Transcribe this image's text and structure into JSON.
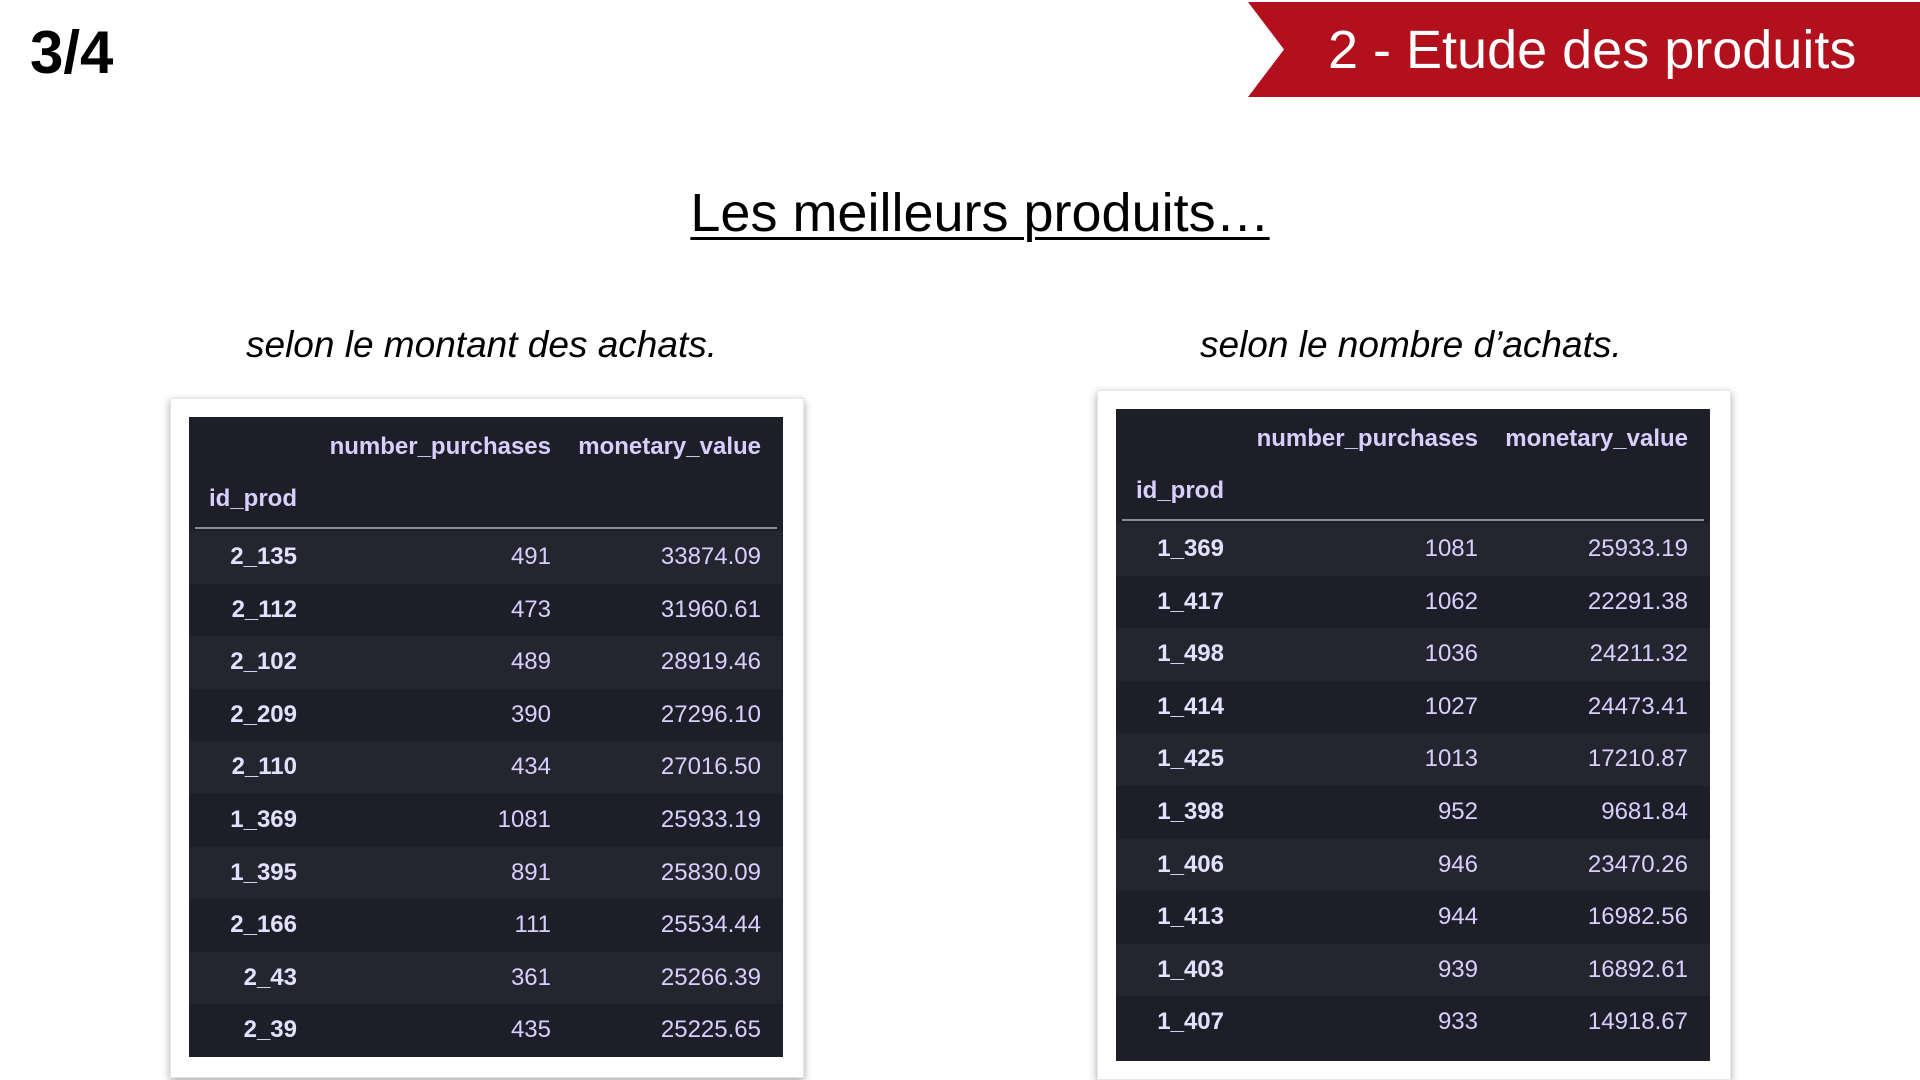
{
  "page_number": "3/4",
  "section_banner": "2 - Etude des produits",
  "title": "Les meilleurs produits…",
  "left": {
    "subtitle": "selon le montant des achats.",
    "columns": [
      "number_purchases",
      "monetary_value"
    ],
    "index_name": "id_prod",
    "rows": [
      {
        "id": "2_135",
        "number_purchases": "491",
        "monetary_value": "33874.09"
      },
      {
        "id": "2_112",
        "number_purchases": "473",
        "monetary_value": "31960.61"
      },
      {
        "id": "2_102",
        "number_purchases": "489",
        "monetary_value": "28919.46"
      },
      {
        "id": "2_209",
        "number_purchases": "390",
        "monetary_value": "27296.10"
      },
      {
        "id": "2_110",
        "number_purchases": "434",
        "monetary_value": "27016.50"
      },
      {
        "id": "1_369",
        "number_purchases": "1081",
        "monetary_value": "25933.19"
      },
      {
        "id": "1_395",
        "number_purchases": "891",
        "monetary_value": "25830.09"
      },
      {
        "id": "2_166",
        "number_purchases": "111",
        "monetary_value": "25534.44"
      },
      {
        "id": "2_43",
        "number_purchases": "361",
        "monetary_value": "25266.39"
      },
      {
        "id": "2_39",
        "number_purchases": "435",
        "monetary_value": "25225.65"
      }
    ]
  },
  "right": {
    "subtitle": "selon le nombre d’achats.",
    "columns": [
      "number_purchases",
      "monetary_value"
    ],
    "index_name": "id_prod",
    "rows": [
      {
        "id": "1_369",
        "number_purchases": "1081",
        "monetary_value": "25933.19"
      },
      {
        "id": "1_417",
        "number_purchases": "1062",
        "monetary_value": "22291.38"
      },
      {
        "id": "1_498",
        "number_purchases": "1036",
        "monetary_value": "24211.32"
      },
      {
        "id": "1_414",
        "number_purchases": "1027",
        "monetary_value": "24473.41"
      },
      {
        "id": "1_425",
        "number_purchases": "1013",
        "monetary_value": "17210.87"
      },
      {
        "id": "1_398",
        "number_purchases": "952",
        "monetary_value": "9681.84"
      },
      {
        "id": "1_406",
        "number_purchases": "946",
        "monetary_value": "23470.26"
      },
      {
        "id": "1_413",
        "number_purchases": "944",
        "monetary_value": "16982.56"
      },
      {
        "id": "1_403",
        "number_purchases": "939",
        "monetary_value": "16892.61"
      },
      {
        "id": "1_407",
        "number_purchases": "933",
        "monetary_value": "14918.67"
      }
    ]
  },
  "colors": {
    "banner": "#b3101e",
    "table_bg": "#1e1e28",
    "table_text": "#d7d0ff"
  }
}
